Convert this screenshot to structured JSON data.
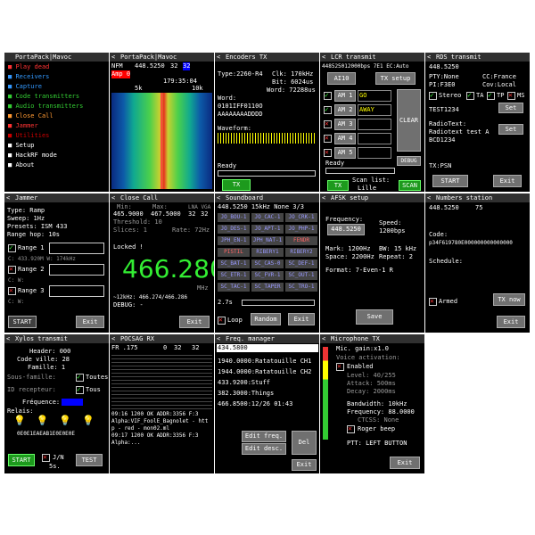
{
  "header_bar": {
    "title": "PortaPack|Mavoc"
  },
  "main_menu": {
    "title": "PortaPack|Mavoc",
    "items": [
      {
        "label": "Play dead",
        "color": "#ff3333"
      },
      {
        "label": "Receivers",
        "color": "#3399ff"
      },
      {
        "label": "Capture",
        "color": "#3399ff"
      },
      {
        "label": "Code transmitters",
        "color": "#33cc33"
      },
      {
        "label": "Audio transmitters",
        "color": "#33cc33"
      },
      {
        "label": "Close Call",
        "color": "#ff9933"
      },
      {
        "label": "Jammer",
        "color": "#ff3333"
      },
      {
        "label": "Utilities",
        "color": "#cc0000"
      },
      {
        "label": "Setup",
        "color": "#ffffff"
      },
      {
        "label": "HackRF mode",
        "color": "#ffffff"
      },
      {
        "label": "About",
        "color": "#ffffff"
      }
    ]
  },
  "spectrum": {
    "title": "PortaPack|Mavoc",
    "mode": "NFM",
    "freq": "448.5250",
    "v1": "32",
    "v2": "32",
    "amp_label": "Amp 0",
    "range": "179:35:04",
    "scale_left": "5k",
    "scale_right": "10k"
  },
  "encoders": {
    "title": "Encoders TX",
    "type": "Type:2260-R4",
    "clk": "Clk: 170kHz",
    "bit": "Bit: 6024us",
    "word_rate": "Word: 72288us",
    "word_label": "Word:",
    "word1": "0101IFF0110O",
    "word2": "AAAAAAAADDDD",
    "waveform_label": "Waveform:",
    "status": "Ready",
    "tx_button": "TX"
  },
  "lcr": {
    "title": "LCR transmit",
    "top": "448525012000bps  7E1  EC:Auto",
    "ai10": "AI10",
    "tx_setup": "TX setup",
    "rows": [
      {
        "label": "AM 1",
        "value": "GO",
        "checked": true
      },
      {
        "label": "AM 2",
        "value": "AWAY",
        "checked": true
      },
      {
        "label": "AM 3",
        "value": "",
        "checked": false
      },
      {
        "label": "AM 4",
        "value": "",
        "checked": false
      },
      {
        "label": "AM 5",
        "value": "",
        "checked": false
      }
    ],
    "clear": "CLEAR",
    "debug": "DEBUG",
    "status": "Ready",
    "tx": "TX",
    "scan_list": "Scan list:",
    "scan_city": "Lille",
    "scan": "SCAN"
  },
  "rds": {
    "title": "RDS transmit",
    "freq": "448.5250",
    "pty": "PTY:None",
    "cc": "CC:France",
    "pi": "PI:F3E0",
    "cov": "Cov:Local",
    "stereo": "Stereo",
    "ta": "TA",
    "tp": "TP",
    "ms": "MS",
    "name": "TEST1234",
    "set": "Set",
    "radiotext": "RadioText:",
    "rt_value": "Radiotext test A",
    "rt2": "BCD1234",
    "tx_psn": "TX:PSN",
    "start": "START",
    "exit": "Exit"
  },
  "jammer": {
    "title": "Jammer",
    "type": "Type: Ramp",
    "sweep": "Sweep:    1Hz",
    "presets": "Presets: ISM 433",
    "hop": "Range hop:   10s",
    "ranges": [
      {
        "label": "Range 1",
        "sub": "C: 433.920M W: 174kHz"
      },
      {
        "label": "Range 2",
        "sub": "C:              W:"
      },
      {
        "label": "Range 3",
        "sub": "C:              W:"
      }
    ],
    "start": "START",
    "exit": "Exit"
  },
  "closecall": {
    "title": "Close Call",
    "min_label": "Min:",
    "max_label": "Max:",
    "lna": "LNA VGA",
    "min": "465.9000",
    "max": "467.5000",
    "lna_v": "32",
    "vga_v": "32",
    "threshold": "Threshold:  10",
    "slices": "Slices: 1",
    "rate": "Rate: 72Hz",
    "locked": "Locked !",
    "big": "466.280",
    "mhz": "MHz",
    "info": "~12kHz: 466.274/466.286",
    "debug": "DEBUG: -",
    "exit": "Exit"
  },
  "soundboard": {
    "title": "Soundboard",
    "top": "448.5250  15kHz  None  3/3",
    "buttons": [
      "JO_BOU-1",
      "JO_CAC-1",
      "JO_CRK-1",
      "JO_DES-1",
      "JO_APT-1",
      "JO_PHP-1",
      "JPH_EN-1",
      "JPH_NAT-1",
      "FENDR",
      "PISTIL",
      "RIBERY1",
      "RIBERY2",
      "SC_BAT-1",
      "SC_CAS-0",
      "SC_DEF-1",
      "SC_ETR-1",
      "SC_FVR-1",
      "SC_OUT-1",
      "SC_TAC-1",
      "SC_TAPER",
      "SC_TRO-1"
    ],
    "duration": "2.7s",
    "loop": "Loop",
    "random": "Random",
    "exit": "Exit"
  },
  "afsk": {
    "title": "AFSK setup",
    "freq_label": "Frequency:",
    "freq": "448.5250",
    "speed_label": "Speed:",
    "speed": "1200bps",
    "mark": "Mark:  1200Hz",
    "bw": "BW: 15 kHz",
    "space": "Space: 2200Hz",
    "repeat": "Repeat:  2",
    "format": "Format: 7-Even-1 R",
    "save": "Save"
  },
  "numbers": {
    "title": "Numbers station",
    "freq": "448.5250",
    "count": "75",
    "code_label": "Code:",
    "code": "p34F619780E000000000000000",
    "schedule": "Schedule:",
    "armed": "Armed",
    "tx_now": "TX now",
    "exit": "Exit"
  },
  "xylos": {
    "title": "Xylos transmit",
    "header": "Header: 000",
    "city": "Code ville: 28",
    "family": "Famille: 1",
    "subfamily": "Sous-famille:",
    "toutes": "Toutes",
    "receiver": "ID recepteur:",
    "tous": "Tous",
    "freq_label": "Fréquence:",
    "relays": "Relais:",
    "code": "0E0E1EAEAB1E0E0E0E",
    "start": "START",
    "jn": "J/N",
    "jn2": "5s.",
    "test": "TEST"
  },
  "pocsag": {
    "title": "POCSAG RX",
    "top": "FR .175",
    "v1": "0",
    "v2": "32",
    "v3": "32",
    "lines": [
      "09:16 1200 OK ADDR:3356 F:3",
      "Alpha:VIF_FoolE_Bagnolet - htt",
      "p - red - mon02.ml",
      "09:17 1200 OK ADDR:3356 F:3",
      "Alpha:..."
    ]
  },
  "freqman": {
    "title": "Freq. manager",
    "input": "434.5800",
    "items": [
      "1940.0000:Ratatouille CH1",
      "1944.0000:Ratatouille CH2",
      "433.9200:Stuff",
      "382.3000:Things",
      "466.8500:12/26 01:43"
    ],
    "edit_freq": "Edit freq.",
    "edit_desc": "Edit desc.",
    "del": "Del",
    "exit": "Exit"
  },
  "mic": {
    "title": "Microphone TX",
    "gain": "Mic. gain:x1.0",
    "voice": "Voice activation:",
    "enabled": "Enabled",
    "level": "Level:  40/255",
    "attack": "Attack: 500ms",
    "decay": "Decay: 2000ms",
    "bw": "Bandwidth:  10kHz",
    "freq": "Frequency:  88.0000",
    "ctcss": "CTCSS: None",
    "roger": "Roger beep",
    "ptt": "PTT: LEFT BUTTON",
    "exit": "Exit"
  }
}
